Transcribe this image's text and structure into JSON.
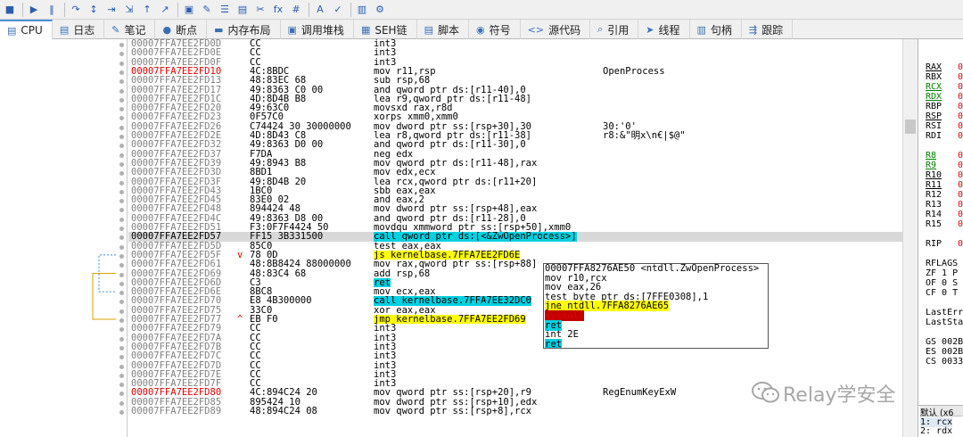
{
  "toolbar": {
    "icons": [
      "stop-icon",
      "run-icon",
      "pause-icon",
      "step-into-icon",
      "step-over-icon",
      "trace-into-icon",
      "trace-over-icon",
      "execute-till-return-icon",
      "run-to-user-code-icon",
      "breakpoint-icon",
      "bookmark-icon",
      "comment-icon",
      "label-icon",
      "patch-icon",
      "function-icon",
      "hash-icon",
      "font-icon",
      "symbols-icon",
      "memory-map-icon",
      "graph-icon"
    ],
    "labels": [
      "■",
      "▶",
      "‖",
      "↷",
      "↕",
      "⇥",
      "⇲",
      "↑",
      "↗",
      "▣",
      "✎",
      "☰",
      "▤",
      "✂",
      "fx",
      "#",
      "A",
      "✓",
      "▥",
      "⚙"
    ]
  },
  "tabs": [
    {
      "label": "CPU",
      "icon": "cpu-icon",
      "glyph": "▤",
      "active": true
    },
    {
      "label": "日志",
      "icon": "log-icon",
      "glyph": "▤"
    },
    {
      "label": "笔记",
      "icon": "notes-icon",
      "glyph": "✎"
    },
    {
      "label": "断点",
      "icon": "breakpoint-icon",
      "glyph": "●"
    },
    {
      "label": "内存布局",
      "icon": "memory-map-icon",
      "glyph": "▬"
    },
    {
      "label": "调用堆栈",
      "icon": "callstack-icon",
      "glyph": "▣"
    },
    {
      "label": "SEH链",
      "icon": "seh-icon",
      "glyph": "▦"
    },
    {
      "label": "脚本",
      "icon": "script-icon",
      "glyph": "▤"
    },
    {
      "label": "符号",
      "icon": "symbols-icon",
      "glyph": "◉"
    },
    {
      "label": "源代码",
      "icon": "source-icon",
      "glyph": "<>"
    },
    {
      "label": "引用",
      "icon": "references-icon",
      "glyph": "⌕"
    },
    {
      "label": "线程",
      "icon": "threads-icon",
      "glyph": "➤"
    },
    {
      "label": "句柄",
      "icon": "handles-icon",
      "glyph": "▥"
    },
    {
      "label": "跟踪",
      "icon": "trace-icon",
      "glyph": "⇶"
    }
  ],
  "rows": [
    {
      "addr": "00007FFA7EE2FD0D",
      "bytes": "CC",
      "ins": "int3",
      "com": ""
    },
    {
      "addr": "00007FFA7EE2FD0E",
      "bytes": "CC",
      "ins": "int3",
      "com": ""
    },
    {
      "addr": "00007FFA7EE2FD0F",
      "bytes": "CC",
      "ins": "int3",
      "com": ""
    },
    {
      "addr": "00007FFA7EE2FD10",
      "bytes": "4C:8BDC",
      "ins": "mov r11,rsp",
      "com": "OpenProcess",
      "red": true
    },
    {
      "addr": "00007FFA7EE2FD13",
      "bytes": "48:83EC 68",
      "ins": "sub rsp,68",
      "com": ""
    },
    {
      "addr": "00007FFA7EE2FD17",
      "bytes": "49:8363 C0 00",
      "ins": "and qword ptr ds:[r11-40],0",
      "com": ""
    },
    {
      "addr": "00007FFA7EE2FD1C",
      "bytes": "4D:8D4B B8",
      "ins": "lea r9,qword ptr ds:[r11-48]",
      "com": ""
    },
    {
      "addr": "00007FFA7EE2FD20",
      "bytes": "49:63C0",
      "ins": "movsxd rax,r8d",
      "com": ""
    },
    {
      "addr": "00007FFA7EE2FD23",
      "bytes": "0F57C0",
      "ins": "xorps xmm0,xmm0",
      "com": ""
    },
    {
      "addr": "00007FFA7EE2FD26",
      "bytes": "C74424 30 30000000",
      "ins": "mov dword ptr ss:[rsp+30],30",
      "com": "30:'0'"
    },
    {
      "addr": "00007FFA7EE2FD2E",
      "bytes": "4D:8D43 C8",
      "ins": "lea r8,qword ptr ds:[r11-38]",
      "com": "r8:&\"明x\\n€|$@\""
    },
    {
      "addr": "00007FFA7EE2FD32",
      "bytes": "49:8363 D0 00",
      "ins": "and qword ptr ds:[r11-30],0",
      "com": ""
    },
    {
      "addr": "00007FFA7EE2FD37",
      "bytes": "F7DA",
      "ins": "neg edx",
      "com": ""
    },
    {
      "addr": "00007FFA7EE2FD39",
      "bytes": "49:8943 B8",
      "ins": "mov qword ptr ds:[r11-48],rax",
      "com": ""
    },
    {
      "addr": "00007FFA7EE2FD3D",
      "bytes": "8BD1",
      "ins": "mov edx,ecx",
      "com": ""
    },
    {
      "addr": "00007FFA7EE2FD3F",
      "bytes": "49:8D4B 20",
      "ins": "lea rcx,qword ptr ds:[r11+20]",
      "com": ""
    },
    {
      "addr": "00007FFA7EE2FD43",
      "bytes": "1BC0",
      "ins": "sbb eax,eax",
      "com": ""
    },
    {
      "addr": "00007FFA7EE2FD45",
      "bytes": "83E0 02",
      "ins": "and eax,2",
      "com": ""
    },
    {
      "addr": "00007FFA7EE2FD48",
      "bytes": "894424 48",
      "ins": "mov dword ptr ss:[rsp+48],eax",
      "com": ""
    },
    {
      "addr": "00007FFA7EE2FD4C",
      "bytes": "49:8363 D8 00",
      "ins": "and qword ptr ds:[r11-28],0",
      "com": ""
    },
    {
      "addr": "00007FFA7EE2FD51",
      "bytes": "F3:0F7F4424 50",
      "ins": "movdqu xmmword ptr ss:[rsp+50],xmm0",
      "com": ""
    },
    {
      "addr": "00007FFA7EE2FD57",
      "bytes": "FF15 3B331500",
      "ins": "call qword ptr ds:[<&ZwOpenProcess>]",
      "com": "",
      "sel": true,
      "hl": "call"
    },
    {
      "addr": "00007FFA7EE2FD5D",
      "bytes": "85C0",
      "ins": "test eax,eax",
      "com": ""
    },
    {
      "addr": "00007FFA7EE2FD5F",
      "bytes": "78 0D",
      "ins": "js kernelbase.7FFA7EE2FD6E",
      "com": "",
      "hl": "jmp",
      "arrow": "v"
    },
    {
      "addr": "00007FFA7EE2FD61",
      "bytes": "48:8B8424 88000000",
      "ins": "mov rax,qword ptr ss:[rsp+88]",
      "com": ""
    },
    {
      "addr": "00007FFA7EE2FD69",
      "bytes": "48:83C4 68",
      "ins": "add rsp,68",
      "com": ""
    },
    {
      "addr": "00007FFA7EE2FD6D",
      "bytes": "C3",
      "ins": "ret",
      "com": "",
      "hl": "call"
    },
    {
      "addr": "00007FFA7EE2FD6E",
      "bytes": "8BC8",
      "ins": "mov ecx,eax",
      "com": ""
    },
    {
      "addr": "00007FFA7EE2FD70",
      "bytes": "E8 4B300000",
      "ins": "call kernelbase.7FFA7EE32DC0",
      "com": "",
      "hl": "call"
    },
    {
      "addr": "00007FFA7EE2FD75",
      "bytes": "33C0",
      "ins": "xor eax,eax",
      "com": ""
    },
    {
      "addr": "00007FFA7EE2FD77",
      "bytes": "EB F0",
      "ins": "jmp kernelbase.7FFA7EE2FD69",
      "com": "",
      "hl": "jmp",
      "arrow": "^"
    },
    {
      "addr": "00007FFA7EE2FD79",
      "bytes": "CC",
      "ins": "int3",
      "com": ""
    },
    {
      "addr": "00007FFA7EE2FD7A",
      "bytes": "CC",
      "ins": "int3",
      "com": ""
    },
    {
      "addr": "00007FFA7EE2FD7B",
      "bytes": "CC",
      "ins": "int3",
      "com": ""
    },
    {
      "addr": "00007FFA7EE2FD7C",
      "bytes": "CC",
      "ins": "int3",
      "com": ""
    },
    {
      "addr": "00007FFA7EE2FD7D",
      "bytes": "CC",
      "ins": "int3",
      "com": ""
    },
    {
      "addr": "00007FFA7EE2FD7E",
      "bytes": "CC",
      "ins": "int3",
      "com": ""
    },
    {
      "addr": "00007FFA7EE2FD7F",
      "bytes": "CC",
      "ins": "int3",
      "com": ""
    },
    {
      "addr": "00007FFA7EE2FD80",
      "bytes": "4C:894C24 20",
      "ins": "mov qword ptr ss:[rsp+20],r9",
      "com": "RegEnumKeyExW",
      "red": true
    },
    {
      "addr": "00007FFA7EE2FD85",
      "bytes": "895424 10",
      "ins": "mov dword ptr ss:[rsp+10],edx",
      "com": ""
    },
    {
      "addr": "00007FFA7EE2FD89",
      "bytes": "48:894C24 08",
      "ins": "mov qword ptr ss:[rsp+8],rcx",
      "com": ""
    }
  ],
  "popup": {
    "lines": [
      {
        "text": "00007FFA8276AE50 <ntdll.ZwOpenProcess>",
        "hl": ""
      },
      {
        "text": "mov r10,rcx",
        "hl": ""
      },
      {
        "text": "mov eax,26",
        "hl": ""
      },
      {
        "text": "test byte ptr ds:[7FFE0308],1",
        "hl": ""
      },
      {
        "text": "jne ntdll.7FFA8276AE65",
        "hl": "jmp"
      },
      {
        "text": "syscall",
        "hl": "sys"
      },
      {
        "text": "ret",
        "hl": "ret"
      },
      {
        "text": "int 2E",
        "hl": ""
      },
      {
        "text": "ret",
        "hl": "ret"
      }
    ]
  },
  "registers": [
    {
      "name": "RAX",
      "mod": true
    },
    {
      "name": "RBX"
    },
    {
      "name": "RCX",
      "mod": true,
      "green": true
    },
    {
      "name": "RDX",
      "mod": true,
      "green": true
    },
    {
      "name": "RBP"
    },
    {
      "name": "RSP",
      "mod": true
    },
    {
      "name": "RSI"
    },
    {
      "name": "RDI"
    },
    {
      "name": ""
    },
    {
      "name": "R8",
      "mod": true,
      "green": true
    },
    {
      "name": "R9",
      "mod": true,
      "green": true
    },
    {
      "name": "R10",
      "mod": true
    },
    {
      "name": "R11",
      "mod": true
    },
    {
      "name": "R12"
    },
    {
      "name": "R13"
    },
    {
      "name": "R14"
    },
    {
      "name": "R15"
    },
    {
      "name": ""
    },
    {
      "name": "RIP"
    },
    {
      "name": ""
    },
    {
      "name": "RFLAGS"
    },
    {
      "name": "ZF 1  P"
    },
    {
      "name": "OF 0  S"
    },
    {
      "name": "CF 0  T"
    },
    {
      "name": ""
    },
    {
      "name": "LastErr"
    },
    {
      "name": "LastSta"
    },
    {
      "name": ""
    },
    {
      "name": "GS 002B"
    },
    {
      "name": "ES 002B"
    },
    {
      "name": "CS 0033"
    }
  ],
  "register_value_glyph": "0",
  "stack_header": "默认 (x6",
  "stack_lines": [
    "1: rcx",
    "2: rdx"
  ],
  "watermark": "Relay学安全",
  "colors": {
    "red": "#e00000",
    "cyan": "#00d0e0",
    "yellow": "#ffff00",
    "green": "#008000",
    "selected": "#d8d8d8"
  }
}
